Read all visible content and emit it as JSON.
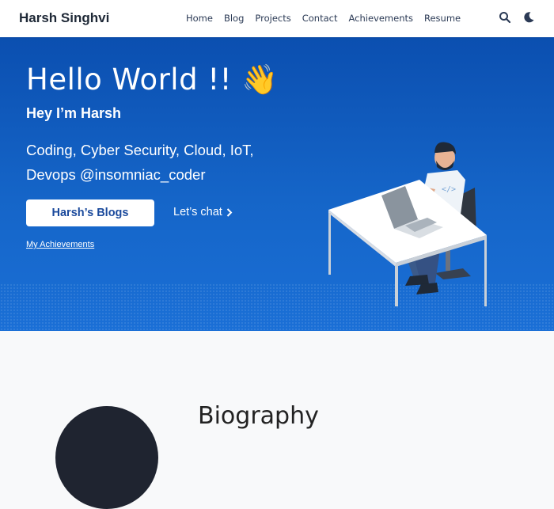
{
  "nav": {
    "brand": "Harsh Singhvi",
    "items": [
      "Home",
      "Blog",
      "Projects",
      "Contact",
      "Achievements",
      "Resume"
    ],
    "search_icon": "search-icon",
    "theme_icon": "moon-icon"
  },
  "hero": {
    "title": "Hello World !! 👋",
    "subtitle": "Hey I’m Harsh",
    "description": "Coding, Cyber Security, Cloud, IoT, Devops @insomniac_coder",
    "primary_button": "Harsh’s Blogs",
    "secondary_button": "Let’s chat",
    "link": "My Achievements",
    "illustration": "developer-at-desk-illustration"
  },
  "bio": {
    "title": "Biography"
  },
  "colors": {
    "hero_top": "#0b4fb0",
    "hero_bottom": "#1a6fd6",
    "nav_bg": "#ffffff",
    "button_text": "#1b4a9c"
  }
}
